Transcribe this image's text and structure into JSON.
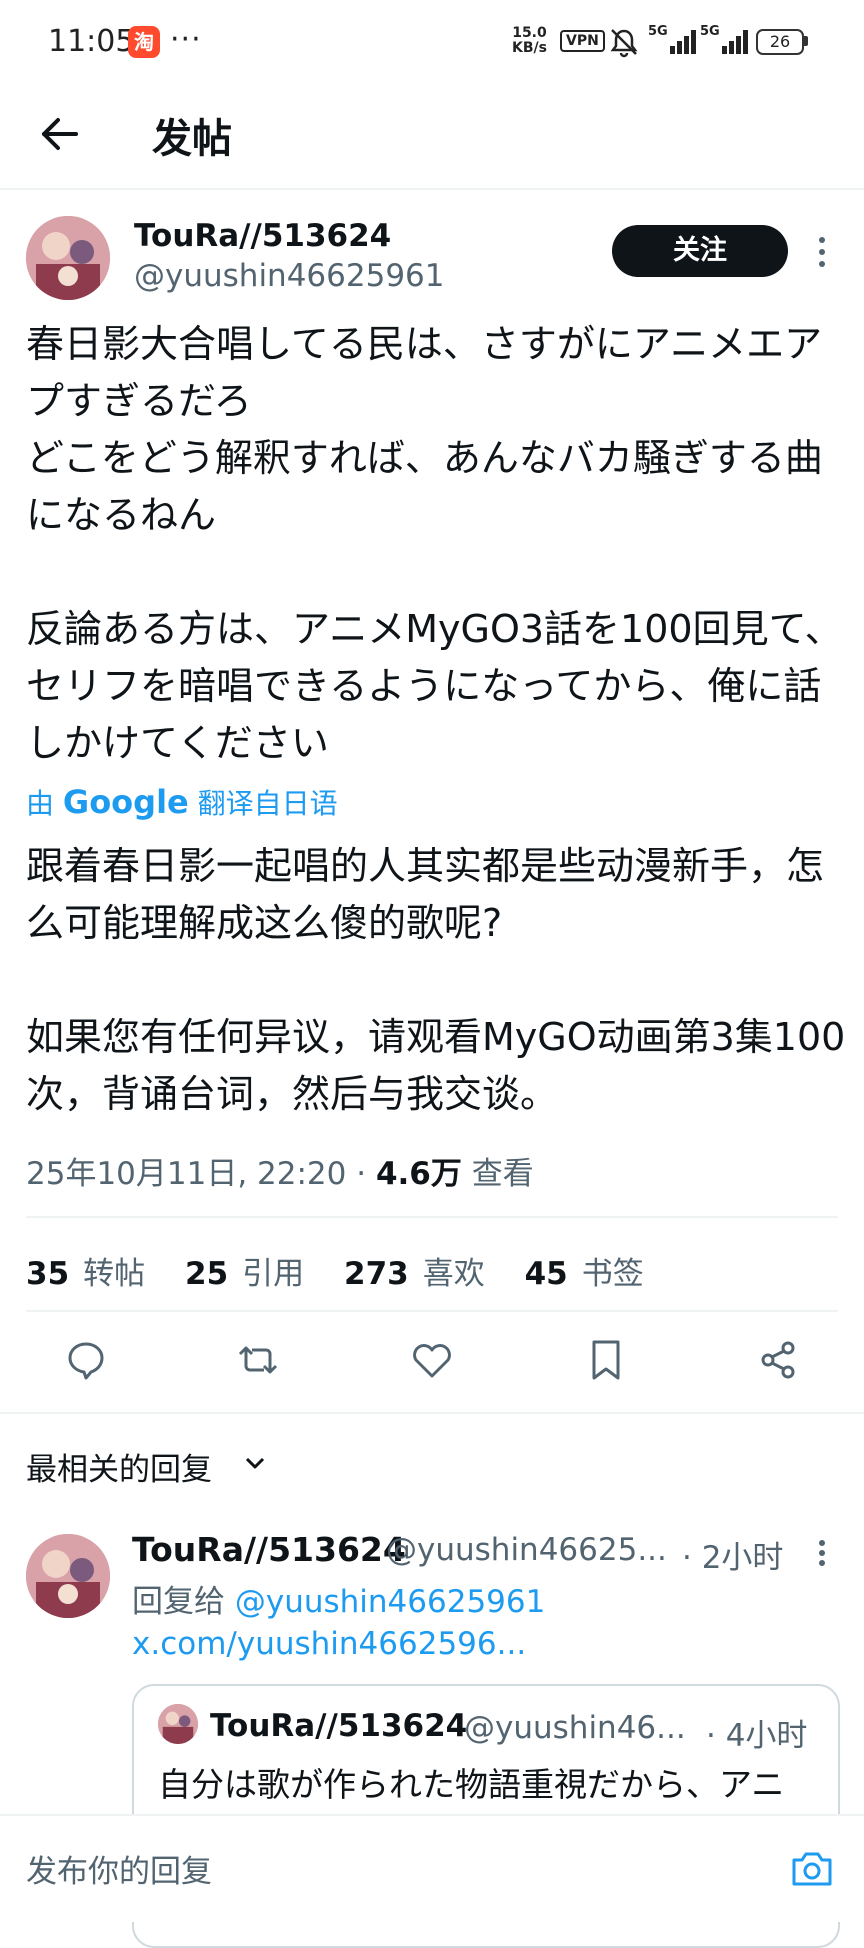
{
  "status_bar": {
    "time": "11:05",
    "app_badge": "淘",
    "more": "···",
    "net_speed_value": "15.0",
    "net_speed_unit": "KB/s",
    "vpn": "VPN",
    "signal_1": "5G",
    "signal_2": "5G",
    "battery": "26"
  },
  "header": {
    "title": "发帖"
  },
  "post": {
    "author_name": "TouRa//513624",
    "author_handle": "@yuushin46625961",
    "follow_label": "关注",
    "text_jp": "春日影大合唱してる民は、さすがにアニメエアプすぎるだろ\nどこをどう解釈すれば、あんなバカ騒ぎする曲になるねん\n\n反論ある方は、アニメMyGO3話を100回見て、セリフを暗唱できるようになってから、俺に話しかけてください",
    "translate_prefix": "由",
    "translate_brand": "Google",
    "translate_suffix": "翻译自日语",
    "text_zh": "跟着春日影一起唱的人其实都是些动漫新手，怎么可能理解成这么傻的歌呢?\n\n如果您有任何异议，请观看MyGO动画第3集100次，背诵台词，然后与我交谈。",
    "timestamp": "25年10月11日, 22:20 · ",
    "views_count": "4.6万",
    "views_label": "查看",
    "stats": [
      {
        "count": "35",
        "label": "转帖"
      },
      {
        "count": "25",
        "label": "引用"
      },
      {
        "count": "273",
        "label": "喜欢"
      },
      {
        "count": "45",
        "label": "书签"
      }
    ]
  },
  "replies": {
    "sort_label": "最相关的回复",
    "items": [
      {
        "name": "TouRa//513624",
        "handle": "@yuushin46625...",
        "time": "· 2小时",
        "reply_to_prefix": "回复给",
        "reply_to_handle": "@yuushin46625961",
        "link": "x.com/yuushin4662596...",
        "quote": {
          "name": "TouRa//513624",
          "handle": "@yuushin46...",
          "time": "· 4小时",
          "text": "自分は歌が作られた物語重視だから、アニ"
        }
      }
    ]
  },
  "composer": {
    "placeholder": "发布你的回复"
  }
}
